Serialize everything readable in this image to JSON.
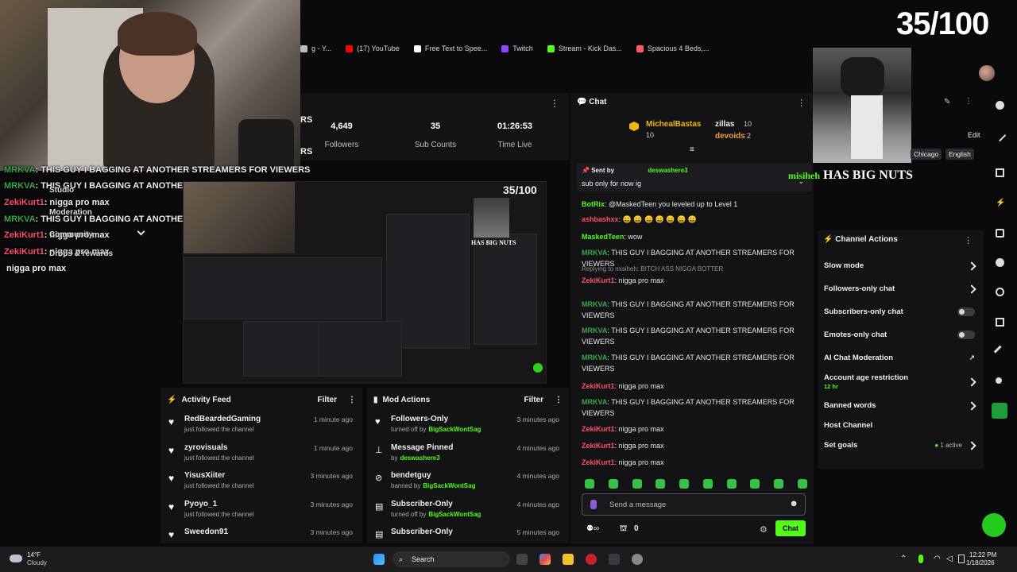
{
  "counter": "35/100",
  "bookmarks": [
    {
      "label": "g - Y...",
      "color": "#bbbbbb"
    },
    {
      "label": "(17) YouTube",
      "color": "#ff0000"
    },
    {
      "label": "Free Text to Spee...",
      "color": "#ffffff"
    },
    {
      "label": "Twitch",
      "color": "#9146ff"
    },
    {
      "label": "Stream - Kick Das...",
      "color": "#53fc18"
    },
    {
      "label": "Spacious 4 Beds,...",
      "color": "#ff5a5f"
    }
  ],
  "overlay": {
    "lines": [
      {
        "user": "MRKVA",
        "sep": ":",
        "text": "THIS GUY I BAGGING AT ANOTHER STREAMERS FOR VIEWERS"
      },
      {
        "user": "MRKVA",
        "sep": ":",
        "text": "THIS GUY I BAGGING AT ANOTHER STREAMERS FOR VIEWERS"
      },
      {
        "user": "ZekiKurt1",
        "sep": ":",
        "text": "nigga pro max"
      },
      {
        "user": "MRKVA",
        "sep": ":",
        "text": "THIS GUY I BAGGING AT ANOTHER STREAMERS FOR VIEWERS"
      },
      {
        "user": "ZekiKurt1",
        "sep": ":",
        "text": "nigga pro max"
      },
      {
        "user": "ZekiKurt1",
        "sep": ":",
        "text": "nigga pro max"
      },
      {
        "user": "",
        "sep": "",
        "text": "nigga pro max"
      }
    ],
    "menu": [
      "Studio",
      "Moderation",
      "Community",
      "Drops & rewards"
    ],
    "stat_fragment": "RS"
  },
  "stats": {
    "followers_value": "4,649",
    "followers_label": "Followers",
    "subs_value": "35",
    "subs_label": "Sub Counts",
    "time_value": "01:26:53",
    "time_label": "Time Live"
  },
  "preview": {
    "counter": "35/100",
    "caption": "HAS BIG NUTS"
  },
  "activity_feed": {
    "title": "Activity Feed",
    "filter": "Filter",
    "items": [
      {
        "name": "RedBeardedGaming",
        "sub": "just followed the channel",
        "time": "1 minute ago"
      },
      {
        "name": "zyrovisuals",
        "sub": "just followed the channel",
        "time": "1 minute ago"
      },
      {
        "name": "YisusXiiter",
        "sub": "just followed the channel",
        "time": "3 minutes ago"
      },
      {
        "name": "Pyoyo_1",
        "sub": "just followed the channel",
        "time": "3 minutes ago"
      },
      {
        "name": "Sweedon91",
        "sub": "",
        "time": "3 minutes ago"
      }
    ]
  },
  "mod_actions": {
    "title": "Mod Actions",
    "filter": "Filter",
    "items": [
      {
        "icon": "heart-icon",
        "name": "Followers-Only",
        "prefix": "turned off by",
        "by": "BigSackWontSag",
        "time": "3 minutes ago"
      },
      {
        "icon": "pin-icon",
        "name": "Message Pinned",
        "prefix": "by",
        "by": "deswashere3",
        "time": "4 minutes ago"
      },
      {
        "icon": "ban-icon",
        "name": "bendetguy",
        "prefix": "banned by",
        "by": "BigSackWontSag",
        "time": "4 minutes ago"
      },
      {
        "icon": "subscriber-icon",
        "name": "Subscriber-Only",
        "prefix": "turned off by",
        "by": "BigSackWontSag",
        "time": "4 minutes ago"
      },
      {
        "icon": "subscriber-icon",
        "name": "Subscriber-Only",
        "prefix": "",
        "by": "",
        "time": "5 minutes ago"
      }
    ]
  },
  "chat": {
    "title": "Chat",
    "leaderboard": [
      {
        "name": "MichealBastas",
        "count": "10"
      },
      {
        "name": "zillas",
        "count": "10"
      },
      {
        "name": "devoids",
        "count": "2"
      }
    ],
    "pinned_sent_by": "Sent by",
    "pinned_user": "deswashere3",
    "pinned_text": "sub only for now ig",
    "messages": [
      {
        "user": "BotRix",
        "color": "#53fc18",
        "text": "@MaskedTeen you leveled up to Level 1"
      },
      {
        "user": "ashbashxx",
        "color": "#ff4f6d",
        "text": "😀 😀 😀 😀 😀 😀 😀"
      },
      {
        "user": "MaskedTeen",
        "color": "#53fc18",
        "text": "wow"
      },
      {
        "user": "MRKVA",
        "color": "#3aa64a",
        "text": "THIS GUY I BAGGING AT ANOTHER STREAMERS FOR VIEWERS"
      },
      {
        "reply": "Replying to misiheh: BITCH ASS NIGGA BOTTER",
        "user": "ZekiKurt1",
        "color": "#ff4f6d",
        "text": "nigga pro max"
      },
      {
        "user": "MRKVA",
        "color": "#3aa64a",
        "text": "THIS GUY I BAGGING AT ANOTHER STREAMERS FOR VIEWERS"
      },
      {
        "user": "MRKVA",
        "color": "#3aa64a",
        "text": "THIS GUY I BAGGING AT ANOTHER STREAMERS FOR VIEWERS"
      },
      {
        "user": "MRKVA",
        "color": "#3aa64a",
        "text": "THIS GUY I BAGGING AT ANOTHER STREAMERS FOR VIEWERS"
      },
      {
        "user": "ZekiKurt1",
        "color": "#ff4f6d",
        "text": "nigga pro max"
      },
      {
        "user": "MRKVA",
        "color": "#3aa64a",
        "text": "THIS GUY I BAGGING AT ANOTHER STREAMERS FOR VIEWERS"
      },
      {
        "user": "ZekiKurt1",
        "color": "#ff4f6d",
        "text": "nigga pro max"
      },
      {
        "user": "ZekiKurt1",
        "color": "#ff4f6d",
        "text": "nigga pro max"
      },
      {
        "user": "ZekiKurt1",
        "color": "#ff4f6d",
        "text": "nigga pro max"
      }
    ],
    "input_placeholder": "Send a message",
    "points": "0",
    "send_label": "Chat"
  },
  "overlay_caption": {
    "user": "misiheh",
    "text": "HAS BIG NUTS"
  },
  "stream_info": {
    "edit": "Edit",
    "tags": [
      "Chicago",
      "English"
    ]
  },
  "channel_actions": {
    "title": "Channel Actions",
    "rows": [
      {
        "label": "Slow mode",
        "control": "chevron"
      },
      {
        "label": "Followers-only chat",
        "control": "chevron"
      },
      {
        "label": "Subscribers-only chat",
        "control": "toggle"
      },
      {
        "label": "Emotes-only chat",
        "control": "toggle"
      },
      {
        "label": "AI Chat Moderation",
        "control": "external"
      },
      {
        "label": "Account age restriction",
        "sub": "12 hr",
        "control": "chevron"
      },
      {
        "label": "Banned words",
        "control": "chevron"
      },
      {
        "label": "Host Channel",
        "control": "none"
      },
      {
        "label": "Set goals",
        "extra": "1 active",
        "control": "chevron"
      }
    ]
  },
  "taskbar": {
    "weather_temp": "14°F",
    "weather_desc": "Cloudy",
    "search": "Search",
    "time": "12:22 PM",
    "date": "1/18/2026"
  },
  "colors": {
    "accent": "#53fc18",
    "panel": "#131316",
    "bg": "#0a0a0c"
  }
}
